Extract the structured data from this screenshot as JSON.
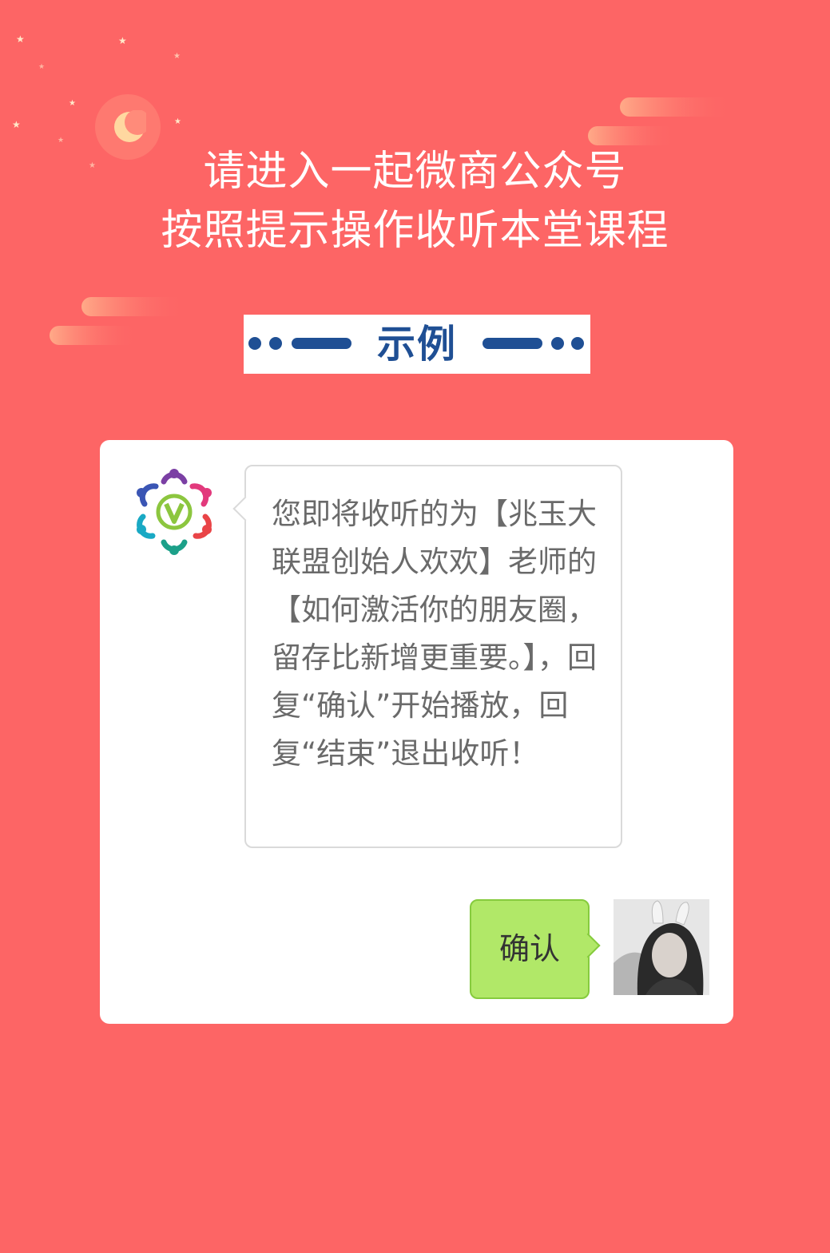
{
  "header": {
    "title_line1": "请进入一起微商公众号",
    "title_line2": "按照提示操作收听本堂课程"
  },
  "banner": {
    "label": "示例"
  },
  "chat": {
    "incoming_message": "您即将收听的为【兆玉大联盟创始人欢欢】老师的【如何激活你的朋友圈，留存比新增更重要。】，回复“确认”开始播放，回复“结束”退出收听！",
    "outgoing_message": "确认"
  },
  "colors": {
    "background": "#fd6565",
    "banner_text": "#1f4f94",
    "outgoing_bubble": "#b1e868",
    "incoming_text": "#6a6a6a"
  },
  "icons": {
    "moon": "crescent-moon-icon",
    "stars": "star-icon",
    "logo": "v-logo-icon",
    "avatar": "user-avatar"
  }
}
